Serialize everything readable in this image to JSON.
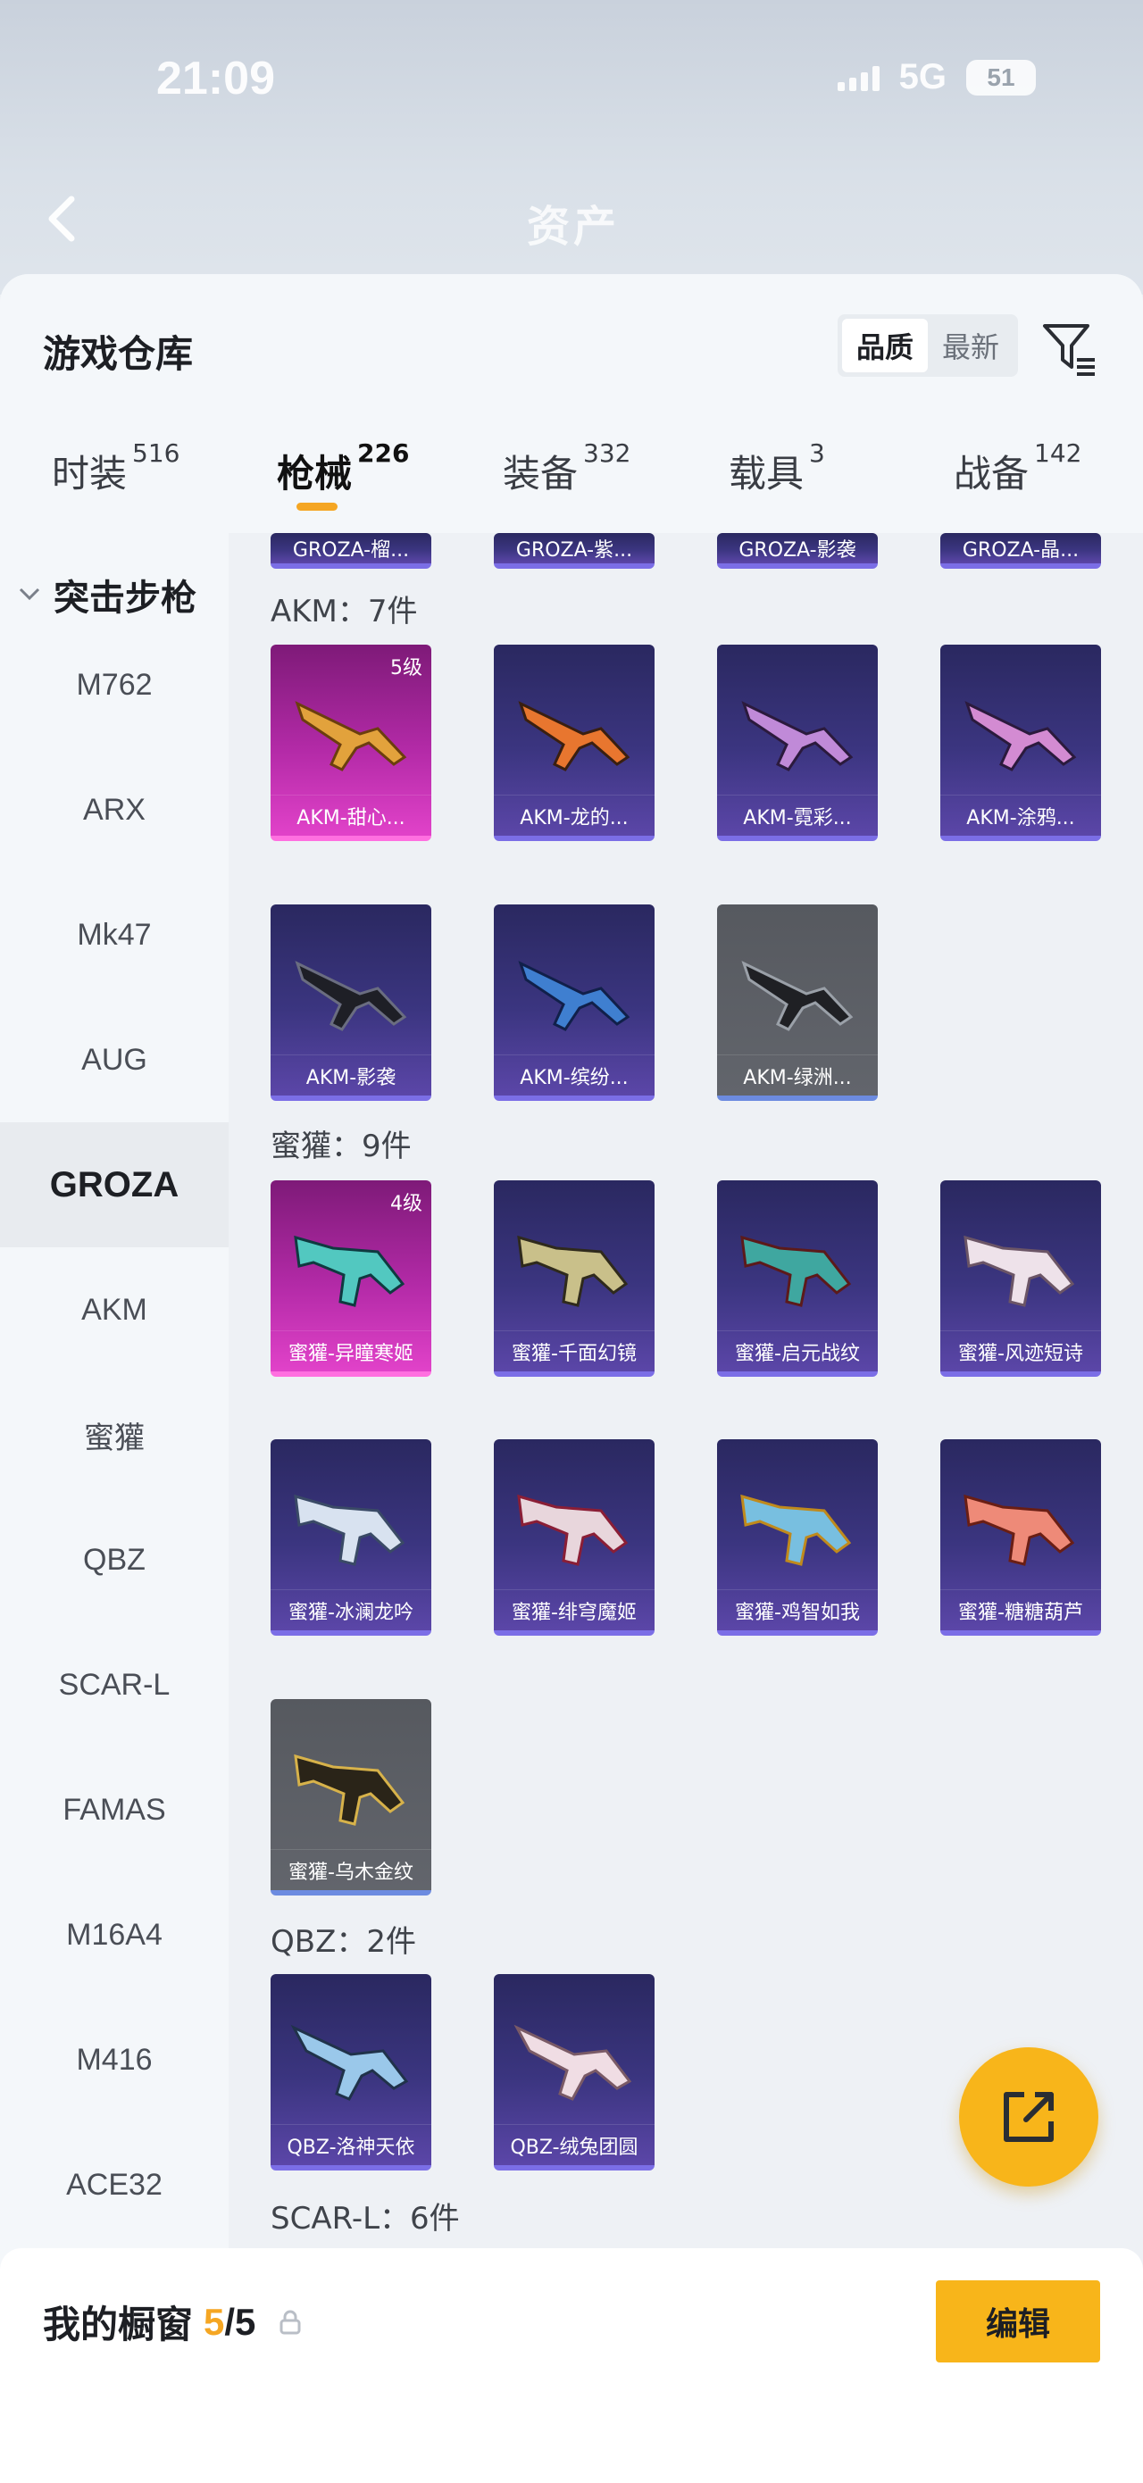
{
  "status_bar": {
    "time": "21:09",
    "network": "5G",
    "battery": "51"
  },
  "header": {
    "back_icon": "chevron-left-icon",
    "blurred_title": "资产"
  },
  "warehouse": {
    "title": "游戏仓库",
    "sort_options": [
      "品质",
      "最新"
    ],
    "sort_active": "品质",
    "filter_icon": "filter-icon"
  },
  "tabs": [
    {
      "label": "时装",
      "count": "516"
    },
    {
      "label": "枪械",
      "count": "226"
    },
    {
      "label": "装备",
      "count": "332"
    },
    {
      "label": "载具",
      "count": "3"
    },
    {
      "label": "战备",
      "count": "142"
    }
  ],
  "active_tab": "枪械",
  "categories": {
    "group_label": "突击步枪",
    "items": [
      "M762",
      "ARX",
      "Mk47",
      "AUG",
      "GROZA",
      "AKM",
      "蜜獾",
      "QBZ",
      "SCAR-L",
      "FAMAS",
      "M16A4",
      "M416",
      "ACE32"
    ],
    "active": "GROZA"
  },
  "partial_row": [
    "GROZA-榴...",
    "GROZA-紫...",
    "GROZA-影袭",
    "GROZA-晶..."
  ],
  "sections": [
    {
      "title": "AKM：7件",
      "items": [
        {
          "name": "AKM-甜心...",
          "level": "5级",
          "tier": "gold"
        },
        {
          "name": "AKM-龙的...",
          "tier": "purple"
        },
        {
          "name": "AKM-霓彩...",
          "tier": "purple"
        },
        {
          "name": "AKM-涂鸦...",
          "tier": "purple"
        },
        {
          "name": "AKM-影袭",
          "tier": "purple"
        },
        {
          "name": "AKM-缤纷...",
          "tier": "purple"
        },
        {
          "name": "AKM-绿洲...",
          "tier": "gray"
        }
      ]
    },
    {
      "title": "蜜獾：9件",
      "items": [
        {
          "name": "蜜獾-异瞳寒姬",
          "level": "4级",
          "tier": "gold"
        },
        {
          "name": "蜜獾-千面幻镜",
          "tier": "purple"
        },
        {
          "name": "蜜獾-启元战纹",
          "tier": "purple"
        },
        {
          "name": "蜜獾-风迹短诗",
          "tier": "purple"
        },
        {
          "name": "蜜獾-冰澜龙吟",
          "tier": "purple"
        },
        {
          "name": "蜜獾-绯穹魔姬",
          "tier": "purple"
        },
        {
          "name": "蜜獾-鸡智如我",
          "tier": "purple"
        },
        {
          "name": "蜜獾-糖糖葫芦",
          "tier": "purple"
        },
        {
          "name": "蜜獾-乌木金纹",
          "tier": "gray"
        }
      ]
    },
    {
      "title": "QBZ：2件",
      "items": [
        {
          "name": "QBZ-洛神天依",
          "tier": "purple"
        },
        {
          "name": "QBZ-绒兔团圆",
          "tier": "purple"
        }
      ]
    },
    {
      "title": "SCAR-L：6件",
      "items": []
    }
  ],
  "fab": {
    "icon": "share-external-icon"
  },
  "showcase": {
    "label": "我的橱窗",
    "current": "5",
    "total": "/5",
    "lock_icon": "lock-icon",
    "edit_label": "编辑"
  },
  "colors": {
    "accent": "#f8b51a",
    "gold_tier": "#d235c0",
    "purple_tier": "#3b3580",
    "gray_tier": "#5d6067"
  }
}
